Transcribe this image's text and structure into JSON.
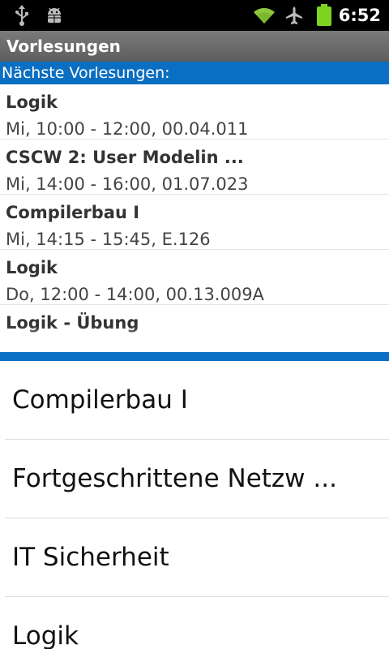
{
  "status_bar": {
    "time": "6:52",
    "icons": [
      "usb-icon",
      "android-debug-icon",
      "wifi-icon",
      "airplane-icon",
      "battery-icon"
    ],
    "battery_color": "#7ed321"
  },
  "app": {
    "title": "Vorlesungen"
  },
  "upcoming": {
    "header": "Nächste Vorlesungen:",
    "items": [
      {
        "title": "Logik",
        "info": "Mi, 10:00 - 12:00, 00.04.011"
      },
      {
        "title": "CSCW 2: User Modelin ...",
        "info": "Mi, 14:00 - 16:00, 01.07.023"
      },
      {
        "title": "Compilerbau I",
        "info": "Mi, 14:15 - 15:45, E.126"
      },
      {
        "title": "Logik",
        "info": "Do, 12:00 - 14:00, 00.13.009A"
      },
      {
        "title": "Logik - Übung",
        "info": ""
      }
    ]
  },
  "courses": {
    "items": [
      {
        "label": "Compilerbau I"
      },
      {
        "label": "Fortgeschrittene Netzw ..."
      },
      {
        "label": "IT Sicherheit"
      },
      {
        "label": "Logik"
      }
    ]
  },
  "colors": {
    "accent_blue": "#0a6fc2",
    "title_bar": "#6b6b6b"
  }
}
